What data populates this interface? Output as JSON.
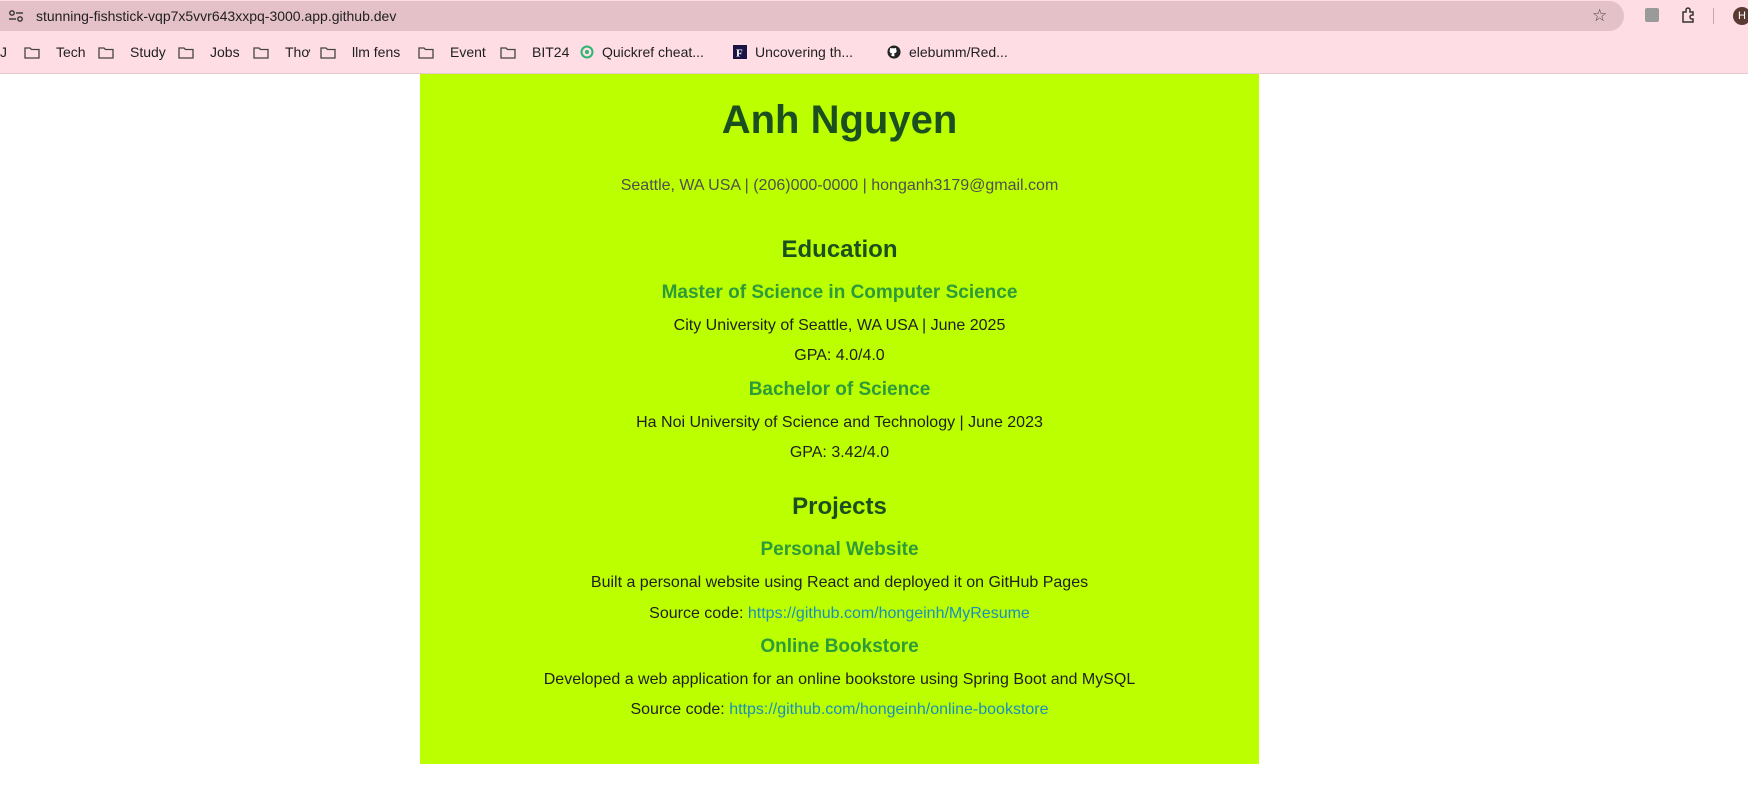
{
  "browser": {
    "url": "stunning-fishstick-vqp7x5vvr643xxpq-3000.app.github.dev",
    "avatar_letter": "H",
    "bookmarks": [
      {
        "label": "J",
        "type": "partial"
      },
      {
        "label": "Tech",
        "type": "folder"
      },
      {
        "label": "Study",
        "type": "folder"
      },
      {
        "label": "Jobs",
        "type": "folder"
      },
      {
        "label": "Thơ",
        "type": "folder"
      },
      {
        "label": "llm fens",
        "type": "folder"
      },
      {
        "label": "Event",
        "type": "folder"
      },
      {
        "label": "BIT24",
        "type": "folder"
      },
      {
        "label": "Quickref cheat...",
        "type": "site",
        "icon": "quickref-icon"
      },
      {
        "label": "Uncovering th...",
        "type": "site",
        "icon": "f-logo-icon"
      },
      {
        "label": "elebumm/Red...",
        "type": "site",
        "icon": "github-icon"
      }
    ]
  },
  "resume": {
    "name": "Anh Nguyen",
    "contact": "Seattle, WA USA | (206)000-0000 | honganh3179@gmail.com",
    "education": {
      "title": "Education",
      "items": [
        {
          "degree": "Master of Science in Computer Science",
          "school": "City University of Seattle, WA USA | June 2025",
          "gpa": "GPA: 4.0/4.0"
        },
        {
          "degree": "Bachelor of Science",
          "school": "Ha Noi University of Science and Technology | June 2023",
          "gpa": "GPA: 3.42/4.0"
        }
      ]
    },
    "projects": {
      "title": "Projects",
      "source_label": "Source code: ",
      "items": [
        {
          "name": "Personal Website",
          "description": "Built a personal website using React and deployed it on GitHub Pages",
          "link": "https://github.com/hongeinh/MyResume"
        },
        {
          "name": "Online Bookstore",
          "description": "Developed a web application for an online bookstore using Spring Boot and MySQL",
          "link": "https://github.com/hongeinh/online-bookstore"
        }
      ]
    }
  },
  "colors": {
    "card_bg": "#bbff00",
    "heading": "#1c4f1f",
    "subheading": "#2d9b3a",
    "link": "#1a8fbd",
    "chrome_bg": "#ffdde5"
  }
}
